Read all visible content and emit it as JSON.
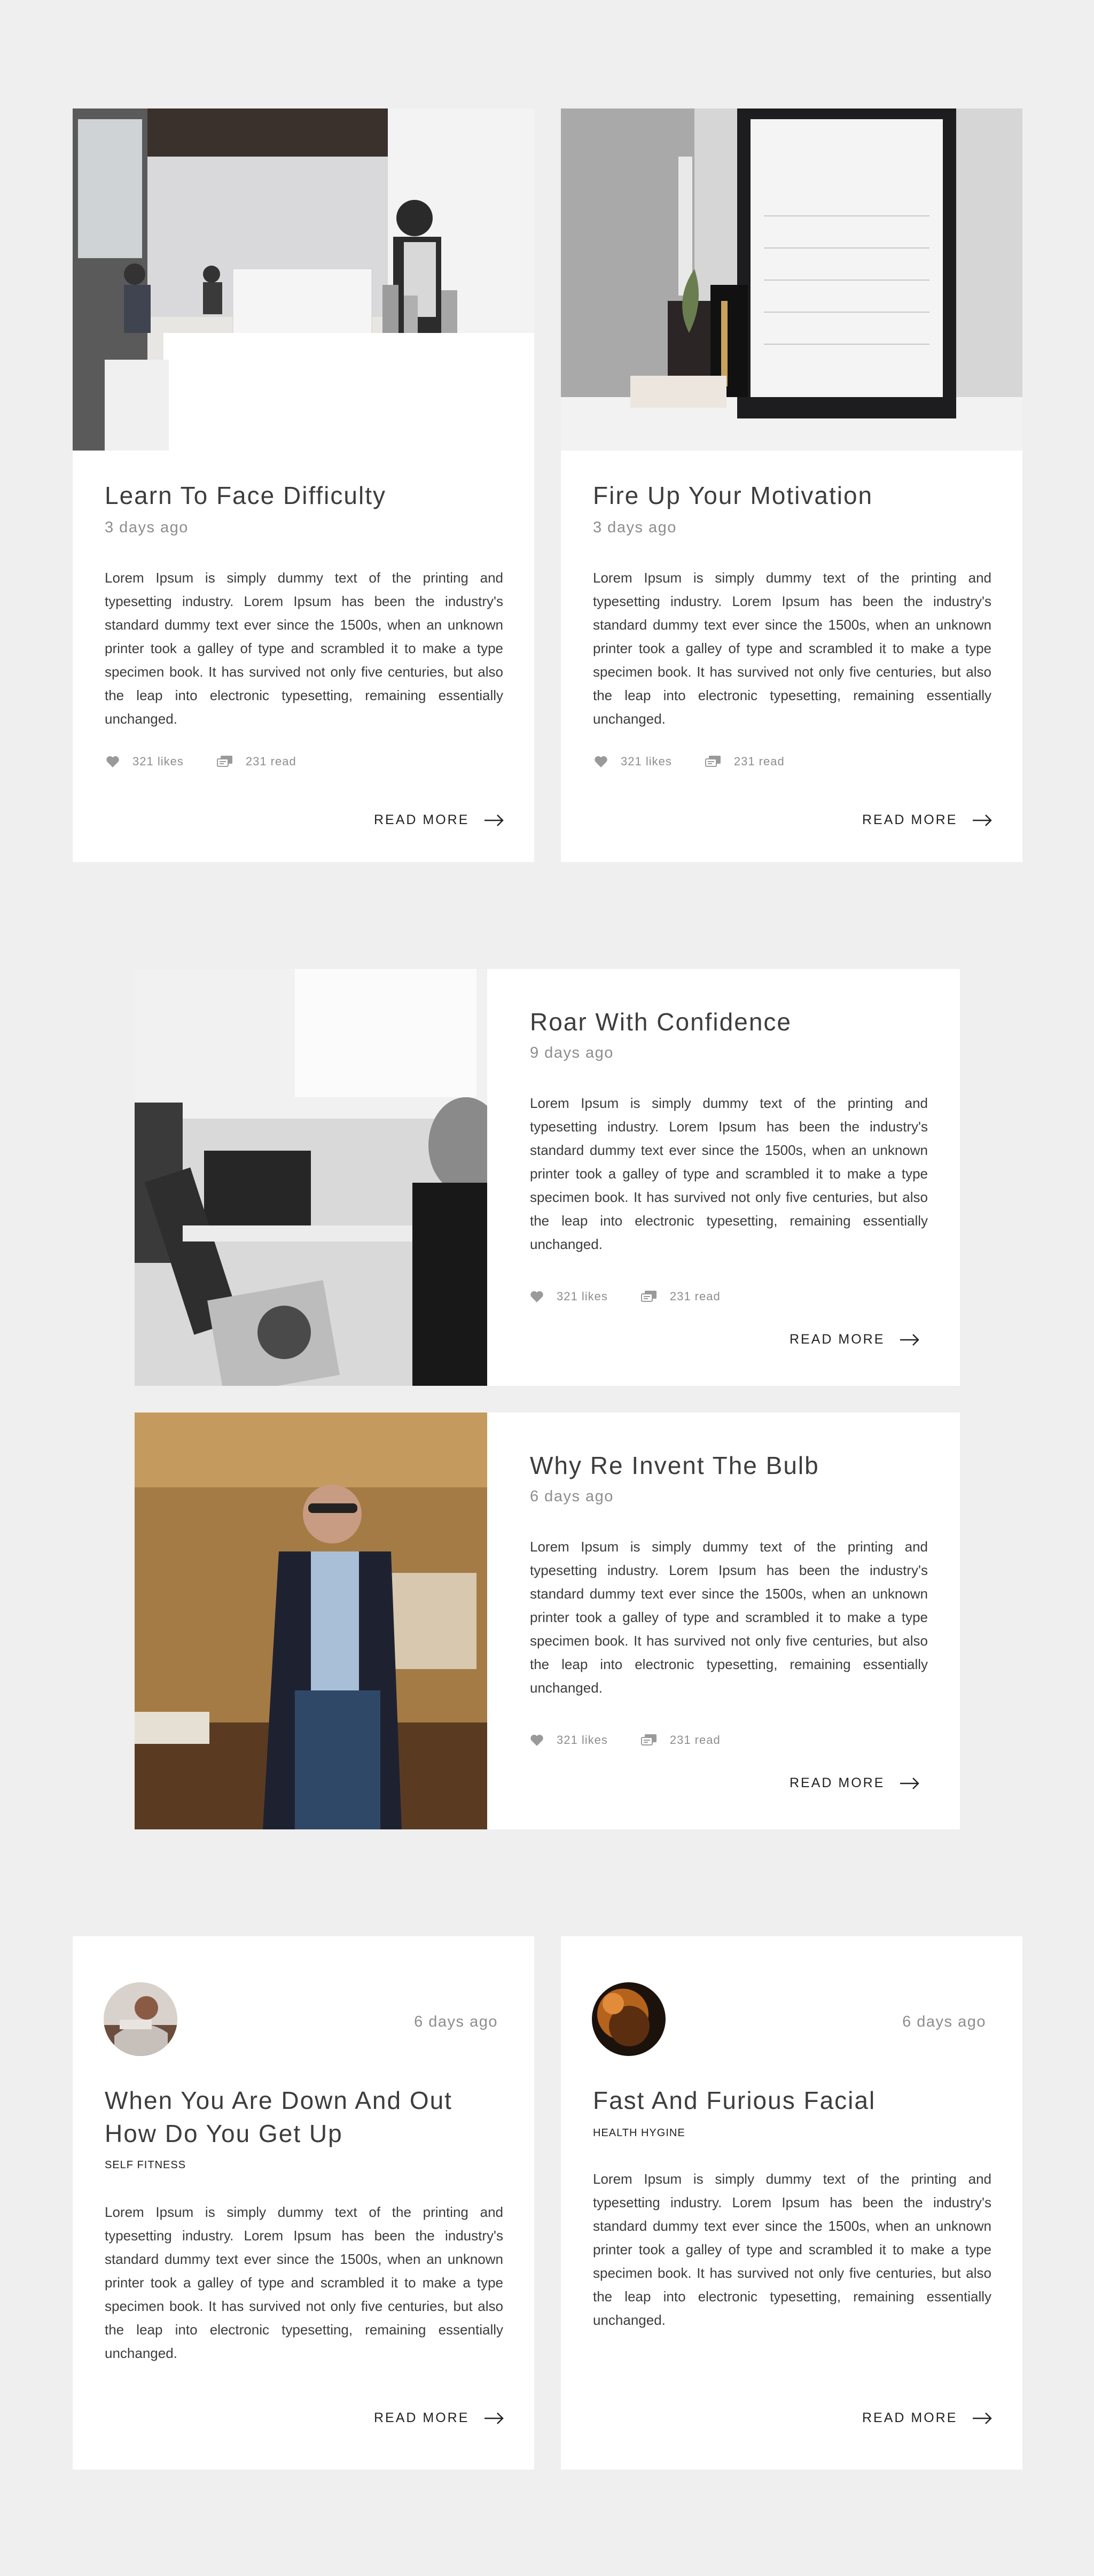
{
  "read_more": "READ MORE",
  "cards": [
    {
      "title": "Learn To Face Difficulty",
      "date": "3 days ago",
      "body": "Lorem Ipsum is simply dummy text of the printing and typesetting industry. Lorem Ipsum has been the industry's standard dummy text ever since the 1500s, when an unknown printer took a galley of type and scrambled it to make a type specimen book. It has survived not only five centuries, but also the leap into electronic typesetting, remaining essentially unchanged.",
      "likes": "321 likes",
      "reads": "231 read"
    },
    {
      "title": "Fire Up Your Motivation",
      "date": "3 days ago",
      "body": "Lorem Ipsum is simply dummy text of the printing and typesetting industry. Lorem Ipsum has been the industry's standard dummy text ever since the 1500s, when an unknown printer took a galley of type and scrambled it to make a type specimen book. It has survived not only five centuries, but also the leap into electronic typesetting, remaining essentially unchanged.",
      "likes": "321 likes",
      "reads": "231 read"
    },
    {
      "title": "Roar With Confidence",
      "date": "9 days ago",
      "body": "Lorem Ipsum is simply dummy text of the printing and typesetting industry. Lorem Ipsum has been the industry's standard dummy text ever since the 1500s, when an unknown printer took a galley of type and scrambled it to make a type specimen book. It has survived not only five centuries, but also the leap into electronic typesetting, remaining essentially unchanged.",
      "likes": "321 likes",
      "reads": "231 read"
    },
    {
      "title": "Why Re Invent The Bulb",
      "date": "6 days ago",
      "body": "Lorem Ipsum is simply dummy text of the printing and typesetting industry. Lorem Ipsum has been the industry's standard dummy text ever since the 1500s, when an unknown printer took a galley of type and scrambled it to make a type specimen book. It has survived not only five centuries, but also the leap into electronic typesetting, remaining essentially unchanged.",
      "likes": "321 likes",
      "reads": "231 read"
    },
    {
      "title_line1": "When You Are Down And Out",
      "title_line2": "How Do You Get Up",
      "date": "6 days ago",
      "category": "SELF FITNESS",
      "body": "Lorem Ipsum is simply dummy text of the printing and typesetting industry. Lorem Ipsum has been the industry's standard dummy text ever since the 1500s, when an unknown printer took a galley of type and scrambled it to make a type specimen book. It has survived not only five centuries, but also the leap into electronic typesetting, remaining essentially unchanged."
    },
    {
      "title": "Fast And Furious Facial",
      "date": "6 days ago",
      "category": "HEALTH HYGINE",
      "body": "Lorem Ipsum is simply dummy text of the printing and typesetting industry. Lorem Ipsum has been the industry's standard dummy text ever since the 1500s, when an unknown printer took a galley of type and scrambled it to make a type specimen book. It has survived not only five centuries, but also the leap into electronic typesetting, remaining essentially unchanged."
    }
  ],
  "icons": {
    "like": "heart-icon",
    "read": "chat-icon",
    "arrow": "arrow-right-icon"
  },
  "colors": {
    "background": "#efefef",
    "card": "#ffffff",
    "title": "#3d3d3d",
    "muted": "#8d8d8d"
  }
}
